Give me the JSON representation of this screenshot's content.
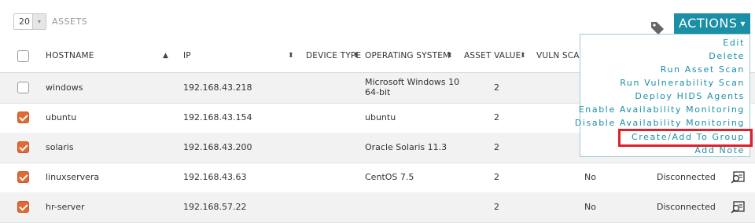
{
  "toolbar": {
    "per_page_value": "20",
    "per_page_caret": "▾",
    "assets_label": "ASSETS",
    "actions_label": "ACTIONS",
    "actions_caret": "▾"
  },
  "table": {
    "columns": {
      "hostname": "HOSTNAME",
      "ip": "IP",
      "device_type": "DEVICE TYPE",
      "operating_system": "OPERATING SYSTEM",
      "asset_value": "ASSET VALUE",
      "vuln_scan": "VULN SCAN"
    },
    "sort_up": "▲",
    "sort_both": "⬍",
    "rows": [
      {
        "hostname": "windows",
        "ip": "192.168.43.218",
        "os": "Microsoft Windows 10",
        "os2": "64-bit",
        "asset_value": "2",
        "vuln_scan": "",
        "status": "",
        "checked": false
      },
      {
        "hostname": "ubuntu",
        "ip": "192.168.43.154",
        "os": "ubuntu",
        "os2": "",
        "asset_value": "2",
        "vuln_scan": "",
        "status": "",
        "checked": true
      },
      {
        "hostname": "solaris",
        "ip": "192.168.43.200",
        "os": "Oracle Solaris 11.3",
        "os2": "",
        "asset_value": "2",
        "vuln_scan": "",
        "status": "",
        "checked": true
      },
      {
        "hostname": "linuxservera",
        "ip": "192.168.43.63",
        "os": "CentOS 7.5",
        "os2": "",
        "asset_value": "2",
        "vuln_scan": "No",
        "status": "Disconnected",
        "checked": true
      },
      {
        "hostname": "hr-server",
        "ip": "192.168.57.22",
        "os": "",
        "os2": "",
        "asset_value": "2",
        "vuln_scan": "No",
        "status": "Disconnected",
        "checked": true
      }
    ]
  },
  "actions_menu": {
    "items": [
      "Edit",
      "Delete",
      "Run Asset Scan",
      "Run Vulnerability Scan",
      "Deploy HIDS Agents",
      "Enable Availability Monitoring",
      "Disable Availability Monitoring",
      "Create/Add To Group",
      "Add Note"
    ],
    "highlighted_item": "Create/Add To Group"
  },
  "colors": {
    "accent": "#1a8fa5",
    "checkbox_checked": "#e06a33",
    "highlight_border": "#e0202a"
  },
  "icons": {
    "tag": "tag-icon",
    "detail": "magnifier-detail-icon"
  }
}
